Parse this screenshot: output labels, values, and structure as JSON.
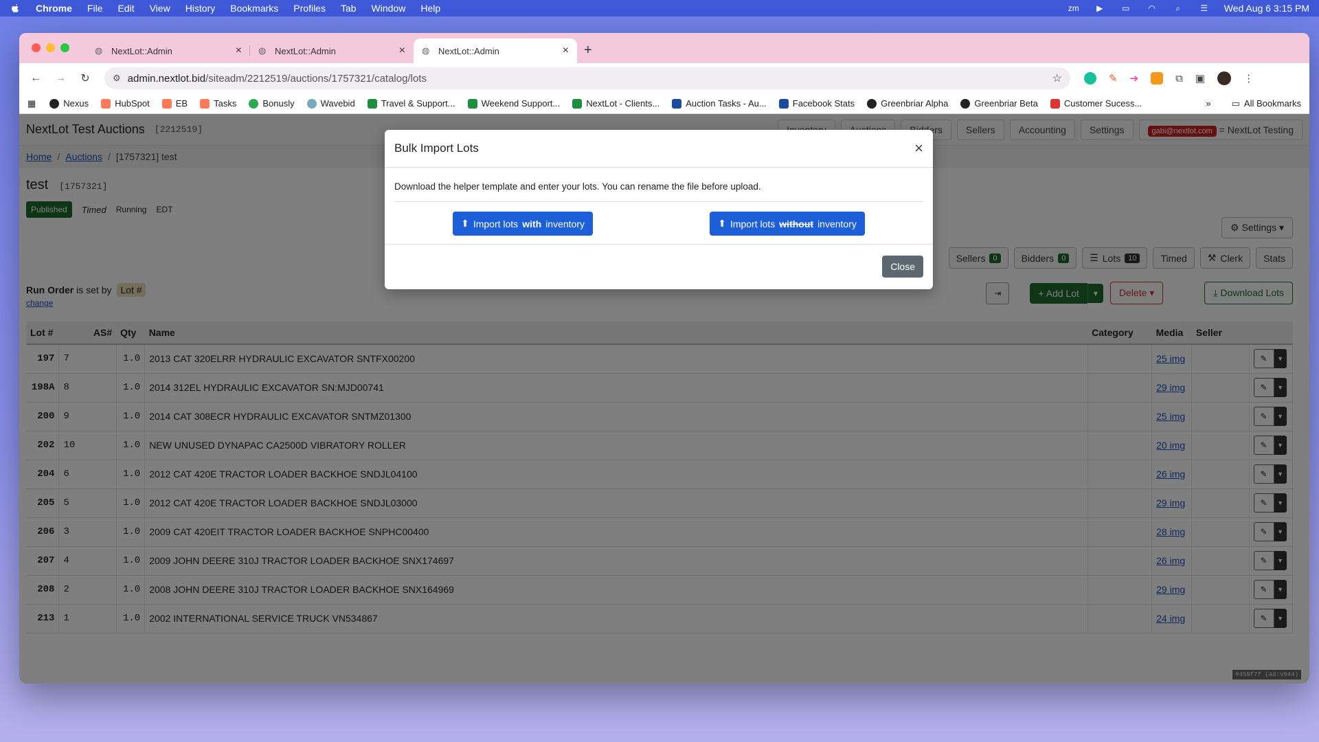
{
  "menubar": {
    "app": "Chrome",
    "items": [
      "File",
      "Edit",
      "View",
      "History",
      "Bookmarks",
      "Profiles",
      "Tab",
      "Window",
      "Help"
    ],
    "clock": "Wed Aug 6  3:15 PM"
  },
  "browser": {
    "tabs": [
      {
        "title": "NextLot::Admin"
      },
      {
        "title": "NextLot::Admin"
      },
      {
        "title": "NextLot::Admin"
      }
    ],
    "url_host": "admin.nextlot.bid",
    "url_path": "/siteadm/2212519/auctions/1757321/catalog/lots",
    "bookmarks": [
      {
        "label": "Nexus",
        "color": "#222"
      },
      {
        "label": "HubSpot",
        "color": "#ff7a59"
      },
      {
        "label": "EB",
        "color": "#ff7a59"
      },
      {
        "label": "Tasks",
        "color": "#ff7a59"
      },
      {
        "label": "Bonusly",
        "color": "#2fa84f"
      },
      {
        "label": "Wavebid",
        "color": "#7ab"
      },
      {
        "label": "Travel & Support...",
        "color": "#1e8e3e"
      },
      {
        "label": "Weekend Support...",
        "color": "#1e8e3e"
      },
      {
        "label": "NextLot - Clients...",
        "color": "#1e8e3e"
      },
      {
        "label": "Auction Tasks - Au...",
        "color": "#1b4b9b"
      },
      {
        "label": "Facebook Stats",
        "color": "#1b4b9b"
      },
      {
        "label": "Greenbriar Alpha",
        "color": "#222"
      },
      {
        "label": "Greenbriar Beta",
        "color": "#222"
      },
      {
        "label": "Customer Sucess...",
        "color": "#d33"
      }
    ],
    "more": "»",
    "all_bookmarks": "All Bookmarks"
  },
  "app": {
    "site_title": "NextLot Test Auctions",
    "site_id": "[2212519]",
    "nav": [
      "Inventory",
      "Auctions",
      "Bidders",
      "Sellers",
      "Accounting",
      "Settings"
    ],
    "user_email": "gabi@nextlot.com",
    "user_org": "NextLot Testing",
    "breadcrumb": {
      "home": "Home",
      "auctions": "Auctions",
      "current": "[1757321] test"
    },
    "auction_name": "test",
    "auction_id": "[1757321]",
    "status": {
      "published": "Published",
      "type": "Timed",
      "state": "Running",
      "tz": "EDT"
    },
    "settings_label": "Settings",
    "counters": {
      "sellers": "Sellers",
      "sellers_count": "0",
      "bidders": "Bidders",
      "bidders_count": "0",
      "lots": "Lots",
      "lots_count": "10",
      "timed": "Timed",
      "clerk": "Clerk",
      "stats": "Stats"
    },
    "run_order": {
      "prefix": "Run Order",
      "mid": "is set by",
      "tag": "Lot #",
      "change": "change"
    },
    "actions": {
      "add_lot": "Add Lot",
      "delete": "Delete",
      "download": "Download Lots"
    },
    "table": {
      "headers": {
        "lot": "Lot #",
        "as": "AS#",
        "qty": "Qty",
        "name": "Name",
        "category": "Category",
        "media": "Media",
        "seller": "Seller"
      },
      "rows": [
        {
          "lot": "197",
          "as": "7",
          "qty": "1.0",
          "name": "2013 CAT 320ELRR HYDRAULIC EXCAVATOR SNTFX00200",
          "media": "25 img"
        },
        {
          "lot": "198A",
          "as": "8",
          "qty": "1.0",
          "name": "2014 312EL HYDRAULIC EXCAVATOR SN:MJD00741",
          "media": "29 img"
        },
        {
          "lot": "200",
          "as": "9",
          "qty": "1.0",
          "name": "2014 CAT 308ECR HYDRAULIC EXCAVATOR SNTMZ01300",
          "media": "25 img"
        },
        {
          "lot": "202",
          "as": "10",
          "qty": "1.0",
          "name": "NEW UNUSED DYNAPAC CA2500D VIBRATORY ROLLER",
          "media": "20 img"
        },
        {
          "lot": "204",
          "as": "6",
          "qty": "1.0",
          "name": "2012 CAT 420E TRACTOR LOADER BACKHOE SNDJL04100",
          "media": "26 img"
        },
        {
          "lot": "205",
          "as": "5",
          "qty": "1.0",
          "name": "2012 CAT 420E TRACTOR LOADER BACKHOE SNDJL03000",
          "media": "29 img"
        },
        {
          "lot": "206",
          "as": "3",
          "qty": "1.0",
          "name": "2009 CAT 420EIT TRACTOR LOADER BACKHOE SNPHC00400",
          "media": "28 img"
        },
        {
          "lot": "207",
          "as": "4",
          "qty": "1.0",
          "name": "2009 JOHN DEERE 310J TRACTOR LOADER BACKHOE SNX174697",
          "media": "26 img"
        },
        {
          "lot": "208",
          "as": "2",
          "qty": "1.0",
          "name": "2008 JOHN DEERE 310J TRACTOR LOADER BACKHOE SNX164969",
          "media": "29 img"
        },
        {
          "lot": "213",
          "as": "1",
          "qty": "1.0",
          "name": "2002 INTERNATIONAL SERVICE TRUCK VN534867",
          "media": "24 img"
        }
      ]
    },
    "version": "#459f7f (ad:v944)"
  },
  "modal": {
    "title": "Bulk Import Lots",
    "description": "Download the helper template and enter your lots. You can rename the file before upload.",
    "btn_with_prefix": "Import lots",
    "btn_with_bold": "with",
    "btn_with_suffix": "inventory",
    "btn_without_prefix": "Import lots",
    "btn_without_strike": "without",
    "btn_without_suffix": "inventory",
    "close_label": "Close",
    "close_icon": "×"
  },
  "colors": {
    "primary": "#1d5fd8",
    "success": "#1e6b2e",
    "danger": "#cc3333"
  }
}
